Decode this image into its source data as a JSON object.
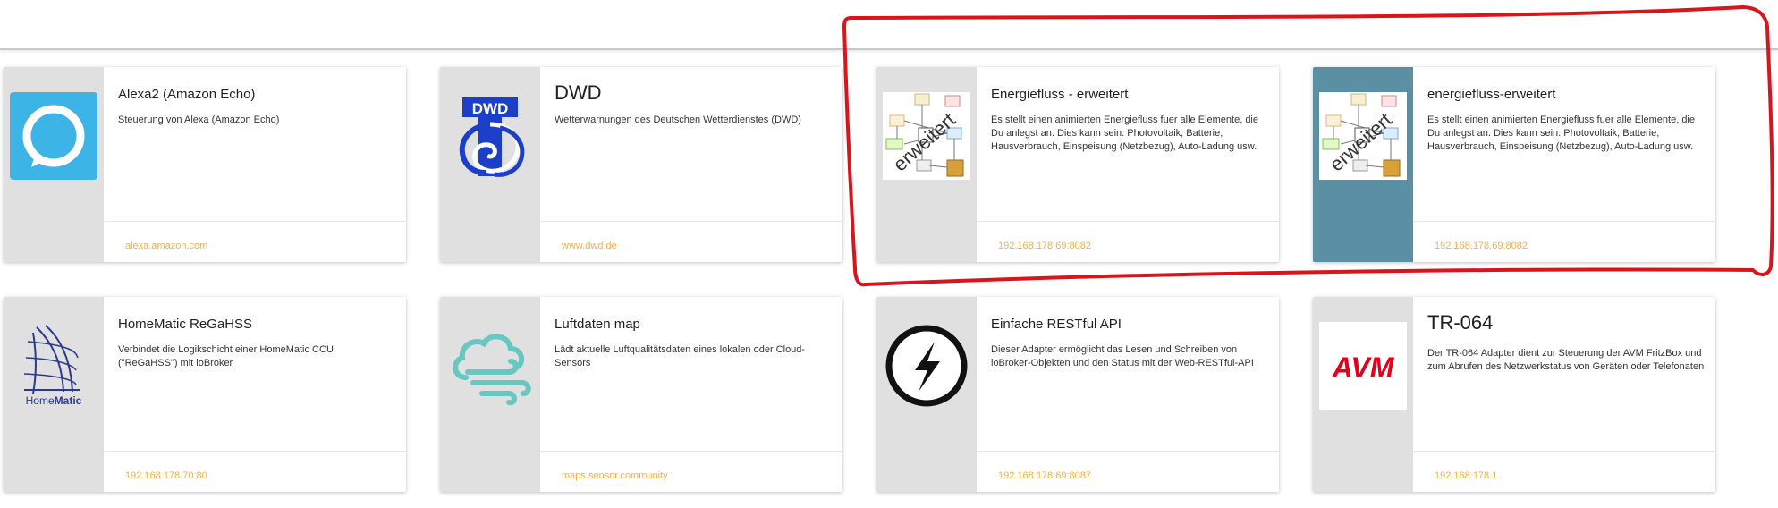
{
  "cards": [
    {
      "title": "Alexa2 (Amazon Echo)",
      "description": "Steuerung von Alexa (Amazon Echo)",
      "url": "alexa.amazon.com",
      "icon": "alexa-icon"
    },
    {
      "title": "DWD",
      "description": "Wetterwarnungen des Deutschen Wetterdienstes (DWD)",
      "url": "www.dwd.de",
      "icon": "dwd-logo-icon",
      "icon_label": "DWD"
    },
    {
      "title": "Energiefluss - erweitert",
      "description": "Es stellt einen animierten Energiefluss fuer alle Elemente, die Du anlegst an. Dies kann sein: Photovoltaik, Batterie, Hausverbrauch, Einspeisung (Netzbezug), Auto-Ladung usw.",
      "url": "192.168.178.69:8082",
      "icon": "energiefluss-diagram-icon",
      "icon_label": "erweitert"
    },
    {
      "title": "energiefluss-erweitert",
      "description": "Es stellt einen animierten Energiefluss fuer alle Elemente, die Du anlegst an. Dies kann sein: Photovoltaik, Batterie, Hausverbrauch, Einspeisung (Netzbezug), Auto-Ladung usw.",
      "url": "192.168.178.69:8082",
      "icon": "energiefluss-diagram-icon",
      "icon_label": "erweitert"
    },
    {
      "title": "HomeMatic ReGaHSS",
      "description": "Verbindet die Logikschicht einer HomeMatic CCU (\"ReGaHSS\") mit ioBroker",
      "url": "192.168.178.70:80",
      "icon": "homematic-logo-icon",
      "icon_label_1": "Home",
      "icon_label_2": "Matic"
    },
    {
      "title": "Luftdaten map",
      "description": "Lädt aktuelle Luftqualitätsdaten eines lokalen oder Cloud-Sensors",
      "url": "maps.sensor.community",
      "icon": "cloud-wind-icon"
    },
    {
      "title": "Einfache RESTful API",
      "description": "Dieser Adapter ermöglicht das Lesen und Schreiben von ioBroker-Objekten und den Status mit der Web-RESTful-API",
      "url": "192.168.178.69:8087",
      "icon": "socket-lightning-icon"
    },
    {
      "title": "TR-064",
      "description": "Der TR-064 Adapter dient zur Steuerung der AVM FritzBox und zum Abrufen des Netzwerkstatus von Geräten oder Telefonaten",
      "url": "192.168.178.1",
      "icon": "avm-logo-icon",
      "icon_label": "AVM"
    }
  ],
  "colors": {
    "url": "#f5b14a",
    "annotation": "#d9141b",
    "alexa": "#3cb4e5",
    "dwd": "#1b3fc8",
    "homematic": "#2a3a8c",
    "luftdaten": "#68c7c0",
    "avm": "#e2001a",
    "teal_side": "#5b8fa3"
  }
}
